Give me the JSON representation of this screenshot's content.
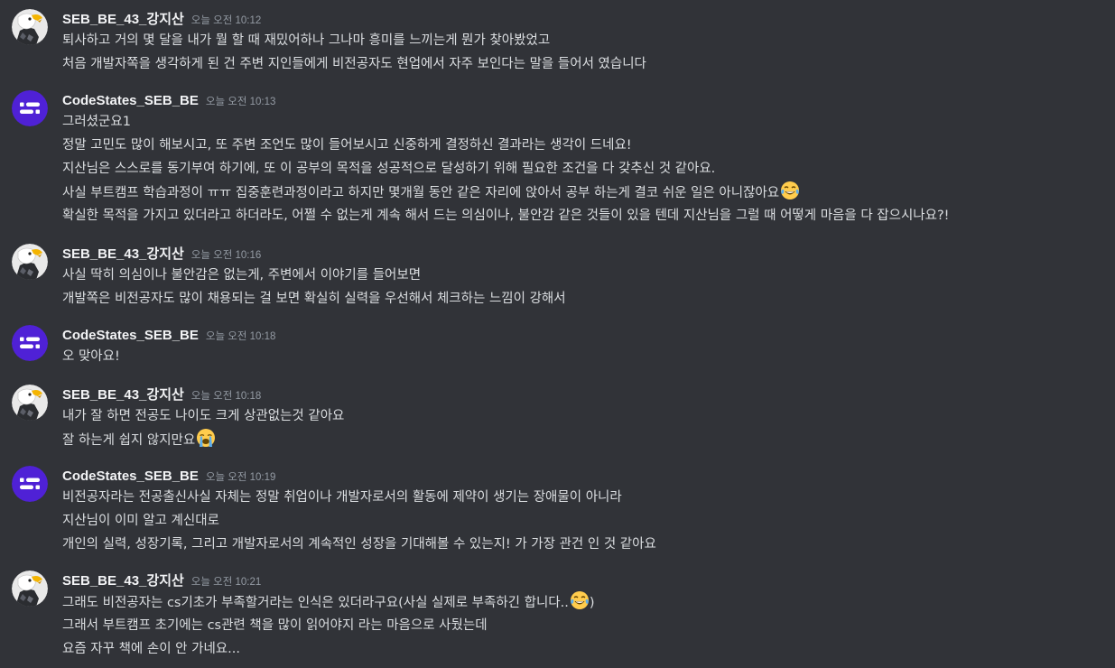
{
  "messages": [
    {
      "username": "SEB_BE_43_강지산",
      "time": "오늘 오전 10:12",
      "avatar": "eagle-avatar",
      "lines": [
        {
          "text": "퇴사하고 거의 몇 달을 내가 뭘 할 때 재밌어하나 그나마 흥미를 느끼는게 뭔가 찾아봤었고"
        },
        {
          "text": "처음 개발자쪽을 생각하게 된 건 주변 지인들에게 비전공자도 현업에서 자주 보인다는 말을 들어서 였습니다"
        }
      ]
    },
    {
      "username": "CodeStates_SEB_BE",
      "time": "오늘 오전 10:13",
      "avatar": "codestates-avatar",
      "lines": [
        {
          "text": "그러셨군요1"
        },
        {
          "text": "정말 고민도 많이 해보시고, 또 주변 조언도 많이 들어보시고 신중하게 결정하신 결과라는 생각이 드네요!"
        },
        {
          "text": "지산님은 스스로를 동기부여 하기에, 또 이 공부의 목적을 성공적으로 달성하기 위해 필요한 조건을 다 갖추신 것 같아요."
        },
        {
          "text": "사실 부트캠프 학습과정이 ㅠㅠ 집중훈련과정이라고 하지만 몇개월 동안 같은 자리에 앉아서 공부 하는게 결코 쉬운 일은 아니잖아요",
          "emoji": "joy-emoji"
        },
        {
          "text": "확실한 목적을 가지고 있더라고 하더라도, 어쩔 수 없는게 계속 해서 드는 의심이나, 불안감 같은 것들이 있을 텐데 지산님을 그럴 때 어떻게 마음을 다 잡으시나요?!"
        }
      ]
    },
    {
      "username": "SEB_BE_43_강지산",
      "time": "오늘 오전 10:16",
      "avatar": "eagle-avatar",
      "lines": [
        {
          "text": "사실 딱히 의심이나 불안감은 없는게, 주변에서 이야기를 들어보면"
        },
        {
          "text": "개발쪽은 비전공자도 많이 채용되는 걸 보면 확실히 실력을 우선해서 체크하는 느낌이 강해서"
        }
      ]
    },
    {
      "username": "CodeStates_SEB_BE",
      "time": "오늘 오전 10:18",
      "avatar": "codestates-avatar",
      "lines": [
        {
          "text": "오 맞아요!"
        }
      ]
    },
    {
      "username": "SEB_BE_43_강지산",
      "time": "오늘 오전 10:18",
      "avatar": "eagle-avatar",
      "lines": [
        {
          "text": "내가 잘 하면 전공도 나이도 크게 상관없는것 같아요"
        },
        {
          "text": "잘 하는게 쉽지 않지만요",
          "emoji": "sob-emoji"
        }
      ]
    },
    {
      "username": "CodeStates_SEB_BE",
      "time": "오늘 오전 10:19",
      "avatar": "codestates-avatar",
      "lines": [
        {
          "text": "비전공자라는 전공출신사실 자체는 정말 취업이나 개발자로서의 활동에 제약이 생기는 장애물이 아니라"
        },
        {
          "text": "지산님이 이미 알고 계신대로"
        },
        {
          "text": "개인의 실력, 성장기록, 그리고 개발자로서의 계속적인 성장을 기대해볼 수 있는지! 가 가장 관건 인 것 같아요"
        }
      ]
    },
    {
      "username": "SEB_BE_43_강지산",
      "time": "오늘 오전 10:21",
      "avatar": "eagle-avatar",
      "lines": [
        {
          "text": "그래도 비전공자는 cs기초가 부족할거라는 인식은 있더라구요(사실 실제로 부족하긴 합니다..",
          "emoji": "joy-emoji",
          "suffix": ")"
        },
        {
          "text": "그래서 부트캠프 초기에는 cs관련 책을 많이 읽어야지 라는 마음으로 사뒀는데"
        },
        {
          "text": "요즘 자꾸 책에 손이 안 가네요..."
        }
      ]
    }
  ]
}
